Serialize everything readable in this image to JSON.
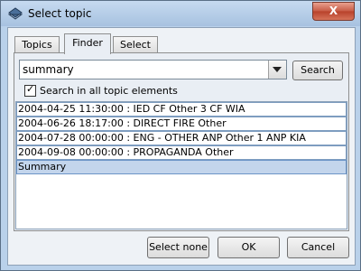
{
  "window": {
    "title": "Select topic",
    "close_label": "X"
  },
  "tabs": [
    {
      "label": "Topics"
    },
    {
      "label": "Finder"
    },
    {
      "label": "Select"
    }
  ],
  "finder": {
    "query": "summary",
    "search_label": "Search",
    "check_label": "Search in all topic elements",
    "check_checked": true,
    "results": [
      "2004-04-25 11:30:00 : IED CF Other 3 CF WIA",
      "2004-06-26 18:17:00 : DIRECT FIRE  Other",
      "2004-07-28 00:00:00 : ENG - OTHER ANP Other 1 ANP KIA",
      "2004-09-08 00:00:00 : PROPAGANDA  Other",
      "Summary"
    ],
    "selected_index": 4
  },
  "footer": {
    "select_none_label": "Select none",
    "ok_label": "OK",
    "cancel_label": "Cancel"
  }
}
